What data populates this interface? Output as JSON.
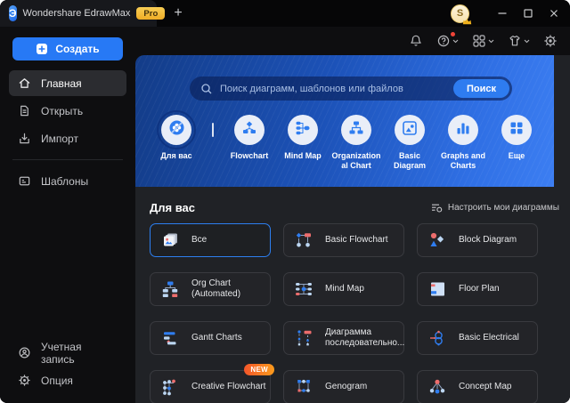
{
  "window": {
    "title": "Wondershare EdrawMax",
    "pro_badge": "Pro",
    "new_tab": "+",
    "avatar_initial": "S"
  },
  "sidebar": {
    "create_label": "Создать",
    "items": [
      {
        "label": "Главная",
        "icon": "home-icon",
        "active": true
      },
      {
        "label": "Открыть",
        "icon": "document-icon",
        "active": false
      },
      {
        "label": "Импорт",
        "icon": "import-icon",
        "active": false
      },
      {
        "label": "Шаблоны",
        "icon": "templates-icon",
        "active": false
      }
    ],
    "bottom_items": [
      {
        "label": "Учетная запись",
        "icon": "account-icon"
      },
      {
        "label": "Опция",
        "icon": "gear-icon"
      }
    ]
  },
  "toolbar": {
    "icons": [
      "bell-icon",
      "help-icon",
      "apps-icon",
      "theme-icon",
      "settings-icon"
    ],
    "help_has_notification_dot": true
  },
  "header": {
    "search": {
      "placeholder": "Поиск диаграмм, шаблонов или файлов",
      "button_label": "Поиск"
    },
    "categories": [
      {
        "label": "Для вас",
        "icon": "for-you-icon",
        "selected": true
      },
      {
        "label": "Flowchart",
        "icon": "flowchart-icon",
        "selected": false
      },
      {
        "label": "Mind Map",
        "icon": "mind-map-icon",
        "selected": false
      },
      {
        "label": "Organizational Chart",
        "icon": "org-chart-icon",
        "selected": false
      },
      {
        "label": "Basic Diagram",
        "icon": "basic-diagram-icon",
        "selected": false
      },
      {
        "label": "Graphs and Charts",
        "icon": "graphs-icon",
        "selected": false
      },
      {
        "label": "Еще",
        "icon": "more-icon",
        "selected": false
      }
    ]
  },
  "main": {
    "section_title": "Для вас",
    "customize_link": "Настроить мои диаграммы",
    "cards": [
      {
        "label": "Все",
        "icon": "all-templates-icon",
        "selected": true
      },
      {
        "label": "Basic Flowchart",
        "icon": "basic-flowchart-icon",
        "selected": false
      },
      {
        "label": "Block Diagram",
        "icon": "block-diagram-icon",
        "selected": false
      },
      {
        "label": "Org Chart (Automated)",
        "icon": "org-chart-automated-icon",
        "selected": false
      },
      {
        "label": "Mind Map",
        "icon": "mind-map-card-icon",
        "selected": false
      },
      {
        "label": "Floor Plan",
        "icon": "floor-plan-icon",
        "selected": false
      },
      {
        "label": "Gantt Charts",
        "icon": "gantt-icon",
        "selected": false
      },
      {
        "label": "Диаграмма последовательно...",
        "icon": "sequence-diagram-icon",
        "selected": false
      },
      {
        "label": "Basic Electrical",
        "icon": "electrical-icon",
        "selected": false
      },
      {
        "label": "Creative Flowchart",
        "icon": "creative-flowchart-icon",
        "selected": false,
        "badge": "NEW"
      },
      {
        "label": "Genogram",
        "icon": "genogram-icon",
        "selected": false
      },
      {
        "label": "Concept Map",
        "icon": "concept-map-icon",
        "selected": false
      }
    ]
  },
  "colors": {
    "accent": "#2e7cf0",
    "header_gradient_start": "#133c88",
    "header_gradient_end": "#3c7ef2",
    "pro_badge": "#f2b02c",
    "new_badge": "#fb7a1d",
    "panel_bg": "#202226",
    "sidebar_bg": "#0e0e10"
  }
}
